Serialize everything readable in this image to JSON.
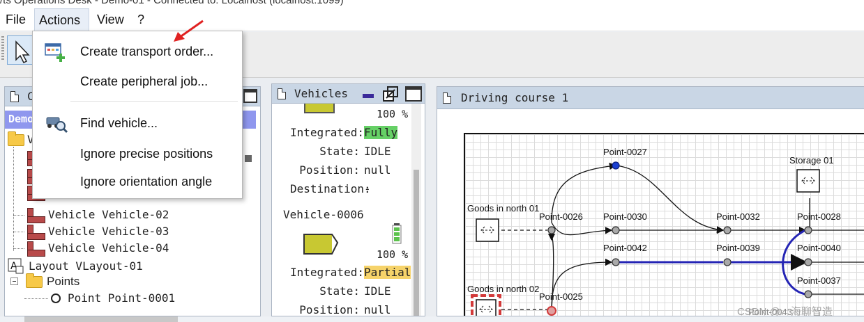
{
  "window": {
    "title": "/ts Operations Desk - Demo-01 - Connected to: Localhost (localhost:1099)"
  },
  "menubar": {
    "file": "File",
    "actions": "Actions",
    "view": "View",
    "help": "?"
  },
  "actions_menu": {
    "items": [
      {
        "label": "Create transport order...",
        "icon": "transport-order-icon"
      },
      {
        "label": "Create peripheral job..."
      },
      {
        "label": "Find vehicle...",
        "icon": "find-vehicle-icon"
      },
      {
        "label": "Ignore precise positions"
      },
      {
        "label": "Ignore orientation angle"
      }
    ]
  },
  "tree_panel": {
    "title_fragment": "C",
    "model_fragment": "Demo",
    "folder_fragment": "V",
    "vehicles": [
      "Vehicle Vehicle-02",
      "Vehicle Vehicle-03",
      "Vehicle Vehicle-04"
    ],
    "layout": "Layout VLayout-01",
    "points_folder": "Points",
    "point": "Point Point-0001"
  },
  "vehicles_panel": {
    "title": "Vehicles",
    "labels": {
      "integrated": "Integrated:",
      "state": "State:",
      "position": "Position:",
      "destination": "Destination:"
    },
    "vehicle1": {
      "battery": "100 %",
      "integrated": "Fully",
      "state": "IDLE",
      "position": "null",
      "destination": "-"
    },
    "vehicle2": {
      "name": "Vehicle-0006",
      "battery": "100 %",
      "integrated": "Partial",
      "state": "IDLE",
      "position": "null"
    },
    "colors": {
      "fully": "#66d066",
      "partial": "#f6d36a",
      "vehicle_body": "#c8c832"
    }
  },
  "course_panel": {
    "title": "Driving course 1",
    "labels": {
      "p27": "Point-0027",
      "storage": "Storage 01",
      "goods_n1": "Goods in north 01",
      "p26": "Point-0026",
      "p30": "Point-0030",
      "p32": "Point-0032",
      "p28": "Point-0028",
      "p42": "Point-0042",
      "p39": "Point-0039",
      "p40": "Point-0040",
      "p37": "Point-0037",
      "goods_n2": "Goods in north 02",
      "p25": "Point-0025",
      "p_partial": "Point-0043"
    },
    "colors": {
      "route": "#2424b4",
      "selected_point": "#1a3fd1",
      "location_selected": "#d23a3a"
    }
  },
  "watermark": "CSDN @…海聊智造"
}
